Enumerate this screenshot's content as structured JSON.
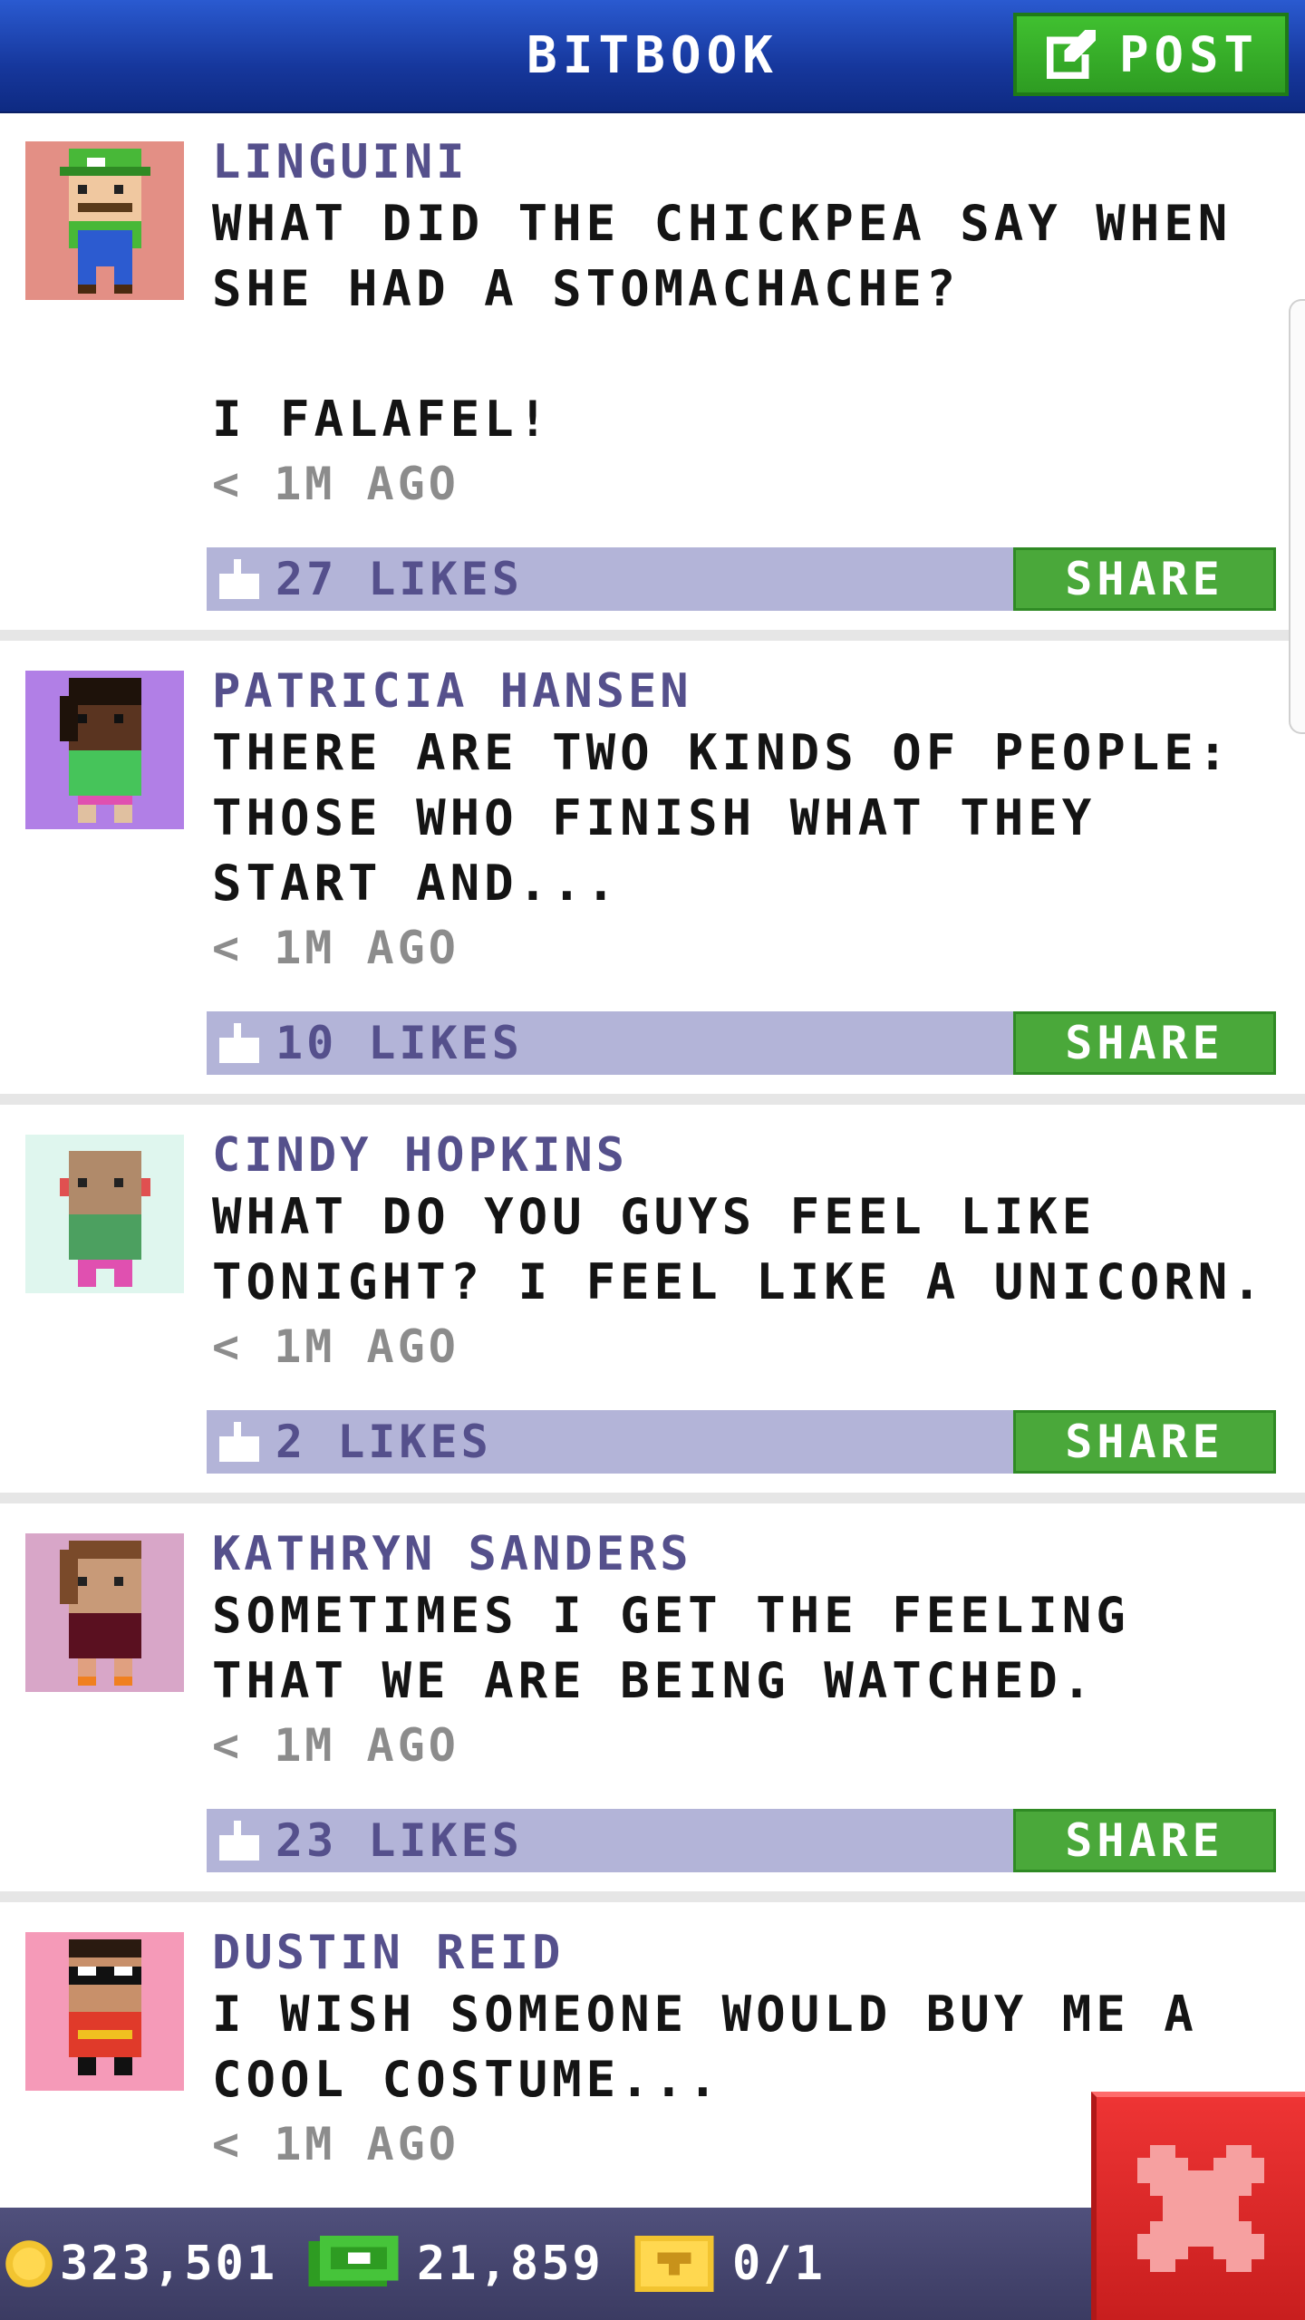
{
  "header": {
    "title": "BITBOOK",
    "post_label": "POST"
  },
  "colors": {
    "header_blue": "#1c44b4",
    "accent_green": "#4aa83a",
    "like_bar": "#b3b4d8",
    "name_purple": "#55508c",
    "close_red": "#e02828"
  },
  "share_label": "SHARE",
  "posts": [
    {
      "author": "LINGUINI",
      "text": "WHAT DID THE CHICKPEA SAY WHEN SHE HAD A STOMACHACHE?\n\nI FALAFEL!",
      "time": "< 1M AGO",
      "likes": "27 LIKES",
      "avatar_color": "#e38f85"
    },
    {
      "author": "PATRICIA HANSEN",
      "text": "THERE ARE TWO KINDS OF PEOPLE: THOSE WHO FINISH WHAT THEY START AND...",
      "time": "< 1M AGO",
      "likes": "10 LIKES",
      "avatar_color": "#b17fe6"
    },
    {
      "author": "CINDY HOPKINS",
      "text": "WHAT DO YOU GUYS FEEL LIKE TONIGHT? I FEEL LIKE A UNICORN.",
      "time": "< 1M AGO",
      "likes": "2 LIKES",
      "avatar_color": "#dff6ee"
    },
    {
      "author": "KATHRYN SANDERS",
      "text": "SOMETIMES I GET THE FEELING THAT WE ARE BEING WATCHED.",
      "time": "< 1M AGO",
      "likes": "23 LIKES",
      "avatar_color": "#d8a6c8"
    },
    {
      "author": "DUSTIN REID",
      "text": "I WISH SOMEONE WOULD BUY ME A COOL COSTUME...",
      "time": "< 1M AGO",
      "likes": "",
      "avatar_color": "#f59ab8"
    }
  ],
  "footer": {
    "coins": "323,501",
    "bux": "21,859",
    "tickets": "0/1"
  }
}
